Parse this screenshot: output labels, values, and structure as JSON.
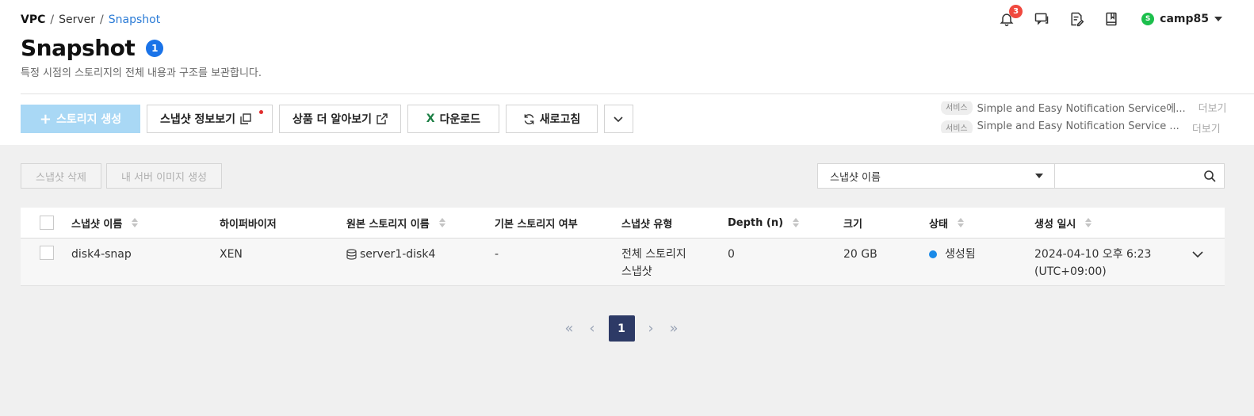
{
  "breadcrumb": {
    "root": "VPC",
    "parent": "Server",
    "current": "Snapshot"
  },
  "header": {
    "title": "Snapshot",
    "info_badge": "1",
    "subtitle": "특정 시점의 스토리지의 전체 내용과 구조를 보관합니다.",
    "notification_count": "3",
    "user_initial": "S",
    "username": "camp85"
  },
  "toolbar": {
    "create_storage": "스토리지 생성",
    "snapshot_info": "스냅샷 정보보기",
    "learn_more": "상품 더 알아보기",
    "download": "다운로드",
    "refresh": "새로고침"
  },
  "ticker": {
    "items": [
      {
        "tag": "서비스",
        "text": "Simple and Easy Notification Service에...",
        "link": "더보기"
      },
      {
        "tag": "서비스",
        "text": "Simple and Easy Notification Service ...",
        "link": "더보기"
      }
    ]
  },
  "actions": {
    "delete_snapshot": "스냅샷 삭제",
    "create_server_image": "내 서버 이미지 생성"
  },
  "search": {
    "selected_field": "스냅샷 이름",
    "value": ""
  },
  "table": {
    "columns": {
      "name": "스냅샷 이름",
      "hypervisor": "하이퍼바이저",
      "source": "원본 스토리지 이름",
      "is_default": "기본 스토리지 여부",
      "type": "스냅샷 유형",
      "depth": "Depth (n)",
      "size": "크기",
      "status": "상태",
      "created": "생성 일시"
    },
    "rows": [
      {
        "name": "disk4-snap",
        "hypervisor": "XEN",
        "source": "server1-disk4",
        "is_default": "-",
        "type_line1": "전체 스토리지",
        "type_line2": "스냅샷",
        "depth": "0",
        "size": "20 GB",
        "status": "생성됨",
        "created_line1": "2024-04-10 오후 6:23",
        "created_line2": "(UTC+09:00)"
      }
    ]
  },
  "pagination": {
    "current": "1"
  },
  "colors": {
    "primary_disabled": "#a9d8f5",
    "accent": "#1a73e8",
    "pager_active": "#2d3a66",
    "status_created": "#1a8ae8",
    "online": "#1cbf4c"
  }
}
